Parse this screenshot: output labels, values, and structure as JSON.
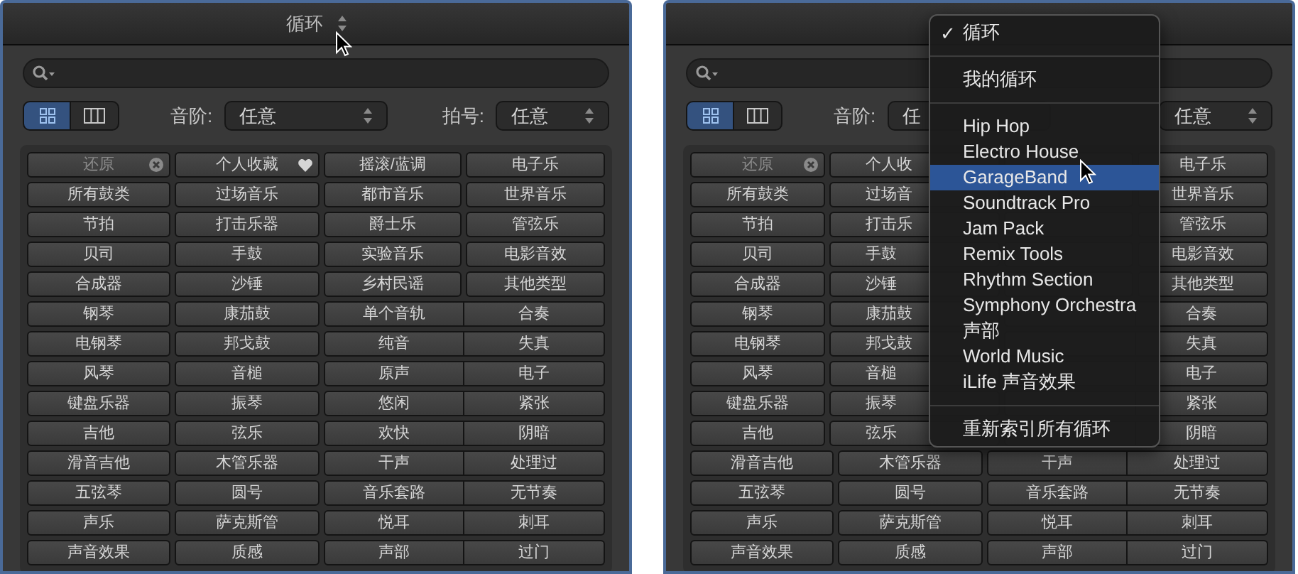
{
  "panels": [
    {
      "title": "循环",
      "scale": {
        "label": "音阶:",
        "value": "任意"
      },
      "signature": {
        "label": "拍号:",
        "value": "任意"
      },
      "view_modes": [
        {
          "kind": "grid",
          "selected": true
        },
        {
          "kind": "columns",
          "selected": false
        }
      ],
      "rows": [
        {
          "paired": false,
          "cells": [
            {
              "kind": "reset",
              "text": "还原"
            },
            {
              "kind": "favorite",
              "text": "个人收藏"
            },
            {
              "kind": "plain",
              "text": "摇滚/蓝调"
            },
            {
              "kind": "plain",
              "text": "电子乐"
            }
          ]
        },
        {
          "paired": false,
          "cells": [
            {
              "kind": "plain",
              "text": "所有鼓类"
            },
            {
              "kind": "plain",
              "text": "过场音乐"
            },
            {
              "kind": "plain",
              "text": "都市音乐"
            },
            {
              "kind": "plain",
              "text": "世界音乐"
            }
          ]
        },
        {
          "paired": false,
          "cells": [
            {
              "kind": "plain",
              "text": "节拍"
            },
            {
              "kind": "plain",
              "text": "打击乐器"
            },
            {
              "kind": "plain",
              "text": "爵士乐"
            },
            {
              "kind": "plain",
              "text": "管弦乐"
            }
          ]
        },
        {
          "paired": false,
          "cells": [
            {
              "kind": "plain",
              "text": "贝司"
            },
            {
              "kind": "plain",
              "text": "手鼓"
            },
            {
              "kind": "plain",
              "text": "实验音乐"
            },
            {
              "kind": "plain",
              "text": "电影音效"
            }
          ]
        },
        {
          "paired": false,
          "cells": [
            {
              "kind": "plain",
              "text": "合成器"
            },
            {
              "kind": "plain",
              "text": "沙锤"
            },
            {
              "kind": "plain",
              "text": "乡村民谣"
            },
            {
              "kind": "plain",
              "text": "其他类型"
            }
          ]
        },
        {
          "paired": true,
          "cells": [
            {
              "kind": "plain",
              "text": "钢琴"
            },
            {
              "kind": "plain",
              "text": "康茄鼓"
            },
            {
              "kind": "plain",
              "text": "单个音轨"
            },
            {
              "kind": "plain",
              "text": "合奏"
            }
          ]
        },
        {
          "paired": true,
          "cells": [
            {
              "kind": "plain",
              "text": "电钢琴"
            },
            {
              "kind": "plain",
              "text": "邦戈鼓"
            },
            {
              "kind": "plain",
              "text": "纯音"
            },
            {
              "kind": "plain",
              "text": "失真"
            }
          ]
        },
        {
          "paired": true,
          "cells": [
            {
              "kind": "plain",
              "text": "风琴"
            },
            {
              "kind": "plain",
              "text": "音槌"
            },
            {
              "kind": "plain",
              "text": "原声"
            },
            {
              "kind": "plain",
              "text": "电子"
            }
          ]
        },
        {
          "paired": true,
          "cells": [
            {
              "kind": "plain",
              "text": "键盘乐器"
            },
            {
              "kind": "plain",
              "text": "振琴"
            },
            {
              "kind": "plain",
              "text": "悠闲"
            },
            {
              "kind": "plain",
              "text": "紧张"
            }
          ]
        },
        {
          "paired": true,
          "cells": [
            {
              "kind": "plain",
              "text": "吉他"
            },
            {
              "kind": "plain",
              "text": "弦乐"
            },
            {
              "kind": "plain",
              "text": "欢快"
            },
            {
              "kind": "plain",
              "text": "阴暗"
            }
          ]
        },
        {
          "paired": true,
          "cells": [
            {
              "kind": "plain",
              "text": "滑音吉他"
            },
            {
              "kind": "plain",
              "text": "木管乐器"
            },
            {
              "kind": "plain",
              "text": "干声"
            },
            {
              "kind": "plain",
              "text": "处理过"
            }
          ]
        },
        {
          "paired": true,
          "cells": [
            {
              "kind": "plain",
              "text": "五弦琴"
            },
            {
              "kind": "plain",
              "text": "圆号"
            },
            {
              "kind": "plain",
              "text": "音乐套路"
            },
            {
              "kind": "plain",
              "text": "无节奏"
            }
          ]
        },
        {
          "paired": true,
          "cells": [
            {
              "kind": "plain",
              "text": "声乐"
            },
            {
              "kind": "plain",
              "text": "萨克斯管"
            },
            {
              "kind": "plain",
              "text": "悦耳"
            },
            {
              "kind": "plain",
              "text": "刺耳"
            }
          ]
        },
        {
          "paired": true,
          "cells": [
            {
              "kind": "plain",
              "text": "声音效果"
            },
            {
              "kind": "plain",
              "text": "质感"
            },
            {
              "kind": "plain",
              "text": "声部"
            },
            {
              "kind": "plain",
              "text": "过门"
            }
          ]
        }
      ]
    },
    {
      "scale": {
        "label": "音阶:",
        "value": "任"
      },
      "signature": {
        "value": "任意"
      },
      "view_modes": [
        {
          "kind": "grid",
          "selected": true
        },
        {
          "kind": "columns",
          "selected": false
        }
      ],
      "rows": [
        {
          "paired": false,
          "cells": [
            {
              "kind": "reset",
              "text": "还原"
            },
            {
              "kind": "clipped",
              "text": "个人收"
            },
            {
              "kind": "covered"
            },
            {
              "kind": "plain",
              "text": "电子乐"
            }
          ]
        },
        {
          "paired": false,
          "cells": [
            {
              "kind": "plain",
              "text": "所有鼓类"
            },
            {
              "kind": "clipped",
              "text": "过场音"
            },
            {
              "kind": "covered"
            },
            {
              "kind": "plain",
              "text": "世界音乐"
            }
          ]
        },
        {
          "paired": false,
          "cells": [
            {
              "kind": "plain",
              "text": "节拍"
            },
            {
              "kind": "clipped",
              "text": "打击乐"
            },
            {
              "kind": "covered"
            },
            {
              "kind": "plain",
              "text": "管弦乐"
            }
          ]
        },
        {
          "paired": false,
          "cells": [
            {
              "kind": "plain",
              "text": "贝司"
            },
            {
              "kind": "clipped",
              "text": "手鼓"
            },
            {
              "kind": "covered"
            },
            {
              "kind": "plain",
              "text": "电影音效"
            }
          ]
        },
        {
          "paired": false,
          "cells": [
            {
              "kind": "plain",
              "text": "合成器"
            },
            {
              "kind": "clipped",
              "text": "沙锤"
            },
            {
              "kind": "covered"
            },
            {
              "kind": "plain",
              "text": "其他类型"
            }
          ]
        },
        {
          "paired": true,
          "cells": [
            {
              "kind": "plain",
              "text": "钢琴"
            },
            {
              "kind": "clipped",
              "text": "康茄鼓"
            },
            {
              "kind": "covered"
            },
            {
              "kind": "plain",
              "text": "合奏"
            }
          ]
        },
        {
          "paired": true,
          "cells": [
            {
              "kind": "plain",
              "text": "电钢琴"
            },
            {
              "kind": "clipped",
              "text": "邦戈鼓"
            },
            {
              "kind": "covered"
            },
            {
              "kind": "plain",
              "text": "失真"
            }
          ]
        },
        {
          "paired": true,
          "cells": [
            {
              "kind": "plain",
              "text": "风琴"
            },
            {
              "kind": "clipped",
              "text": "音槌"
            },
            {
              "kind": "covered"
            },
            {
              "kind": "plain",
              "text": "电子"
            }
          ]
        },
        {
          "paired": true,
          "cells": [
            {
              "kind": "plain",
              "text": "键盘乐器"
            },
            {
              "kind": "clipped",
              "text": "振琴"
            },
            {
              "kind": "covered"
            },
            {
              "kind": "plain",
              "text": "紧张"
            }
          ]
        },
        {
          "paired": true,
          "cells": [
            {
              "kind": "plain",
              "text": "吉他"
            },
            {
              "kind": "clipped",
              "text": "弦乐"
            },
            {
              "kind": "covered"
            },
            {
              "kind": "plain",
              "text": "阴暗"
            }
          ]
        },
        {
          "paired": true,
          "cells": [
            {
              "kind": "plain",
              "text": "滑音吉他"
            },
            {
              "kind": "plain",
              "text": "木管乐器"
            },
            {
              "kind": "plain",
              "text": "干声"
            },
            {
              "kind": "plain",
              "text": "处理过"
            }
          ]
        },
        {
          "paired": true,
          "cells": [
            {
              "kind": "plain",
              "text": "五弦琴"
            },
            {
              "kind": "plain",
              "text": "圆号"
            },
            {
              "kind": "plain",
              "text": "音乐套路"
            },
            {
              "kind": "plain",
              "text": "无节奏"
            }
          ]
        },
        {
          "paired": true,
          "cells": [
            {
              "kind": "plain",
              "text": "声乐"
            },
            {
              "kind": "plain",
              "text": "萨克斯管"
            },
            {
              "kind": "plain",
              "text": "悦耳"
            },
            {
              "kind": "plain",
              "text": "刺耳"
            }
          ]
        },
        {
          "paired": true,
          "cells": [
            {
              "kind": "plain",
              "text": "声音效果"
            },
            {
              "kind": "plain",
              "text": "质感"
            },
            {
              "kind": "plain",
              "text": "声部"
            },
            {
              "kind": "plain",
              "text": "过门"
            }
          ]
        }
      ],
      "menu": [
        {
          "kind": "item",
          "check": "✓",
          "text": "循环",
          "selected": false
        },
        {
          "kind": "separator"
        },
        {
          "kind": "item",
          "text": "我的循环",
          "selected": false
        },
        {
          "kind": "separator"
        },
        {
          "kind": "item",
          "text": "Hip Hop",
          "selected": false
        },
        {
          "kind": "item",
          "text": "Electro House",
          "selected": false
        },
        {
          "kind": "item",
          "text": "GarageBand",
          "selected": true
        },
        {
          "kind": "item",
          "text": "Soundtrack Pro",
          "selected": false
        },
        {
          "kind": "item",
          "text": "Jam Pack",
          "selected": false
        },
        {
          "kind": "item",
          "text": "Remix Tools",
          "selected": false
        },
        {
          "kind": "item",
          "text": "Rhythm Section",
          "selected": false
        },
        {
          "kind": "item",
          "text": "Symphony Orchestra",
          "selected": false
        },
        {
          "kind": "item",
          "text": "声部",
          "selected": false
        },
        {
          "kind": "item",
          "text": "World Music",
          "selected": false
        },
        {
          "kind": "item",
          "text": "iLife 声音效果",
          "selected": false
        },
        {
          "kind": "separator"
        },
        {
          "kind": "item",
          "text": "重新索引所有循环",
          "selected": false
        }
      ]
    }
  ]
}
